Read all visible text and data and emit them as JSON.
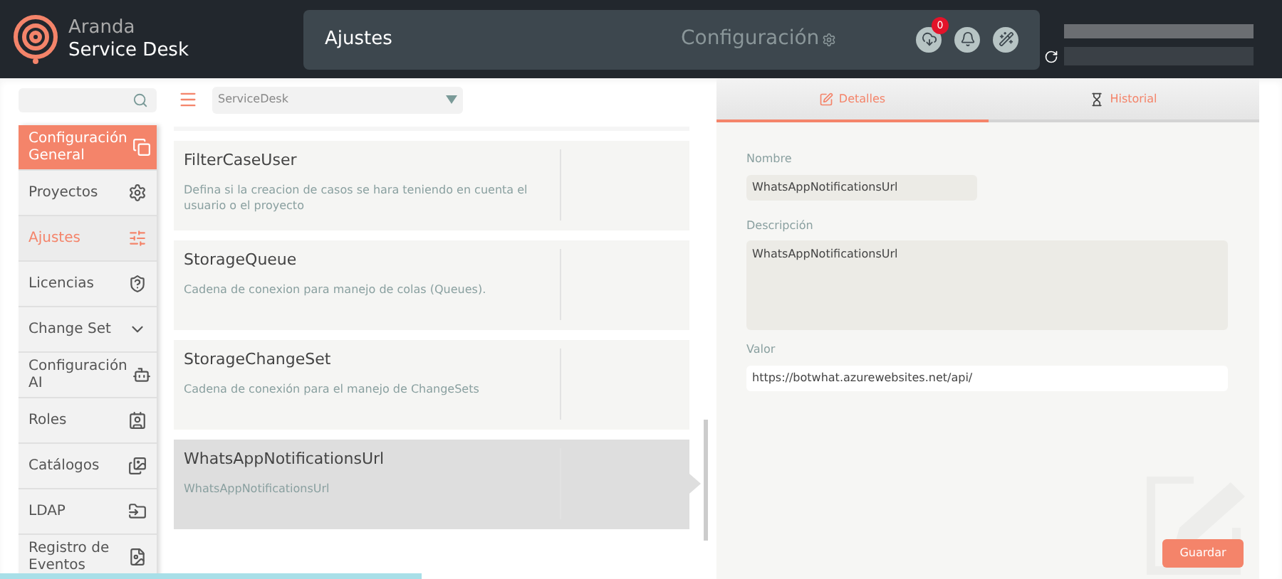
{
  "header": {
    "brand_top": "Aranda",
    "brand_bottom": "Service Desk",
    "page_title": "Ajustes",
    "section": "Configuración",
    "upload_badge": "0"
  },
  "sidebar": {
    "items": [
      {
        "label": "Configuración General",
        "kind": "group",
        "selected": false
      },
      {
        "label": "Proyectos",
        "kind": "link",
        "selected": false
      },
      {
        "label": "Ajustes",
        "kind": "link",
        "selected": true
      },
      {
        "label": "Licencias",
        "kind": "link",
        "selected": false
      },
      {
        "label": "Change Set",
        "kind": "expandable",
        "selected": false
      },
      {
        "label": "Configuración AI",
        "kind": "link",
        "selected": false
      },
      {
        "label": "Roles",
        "kind": "link",
        "selected": false
      },
      {
        "label": "Catálogos",
        "kind": "link",
        "selected": false
      },
      {
        "label": "LDAP",
        "kind": "link",
        "selected": false
      },
      {
        "label": "Registro de Eventos",
        "kind": "link",
        "selected": false
      }
    ]
  },
  "project_select": {
    "value": "ServiceDesk"
  },
  "settings": [
    {
      "name": "FilterCaseUser",
      "description": "Defina si la creacion de casos se hara teniendo en cuenta el usuario o el proyecto",
      "selected": false
    },
    {
      "name": "StorageQueue",
      "description": "Cadena de conexion para manejo de colas (Queues).",
      "selected": false
    },
    {
      "name": "StorageChangeSet",
      "description": "Cadena de conexión para el manejo de ChangeSets",
      "selected": false
    },
    {
      "name": "WhatsAppNotificationsUrl",
      "description": "WhatsAppNotificationsUrl",
      "selected": true
    }
  ],
  "tabs": [
    {
      "label": "Detalles",
      "selected": true
    },
    {
      "label": "Historial",
      "selected": false
    }
  ],
  "form": {
    "name_label": "Nombre",
    "name_value": "WhatsAppNotificationsUrl",
    "description_label": "Descripción",
    "description_value": "WhatsAppNotificationsUrl",
    "value_label": "Valor",
    "value_value": "https://botwhat.azurewebsites.net/api/",
    "save": "Guardar"
  }
}
